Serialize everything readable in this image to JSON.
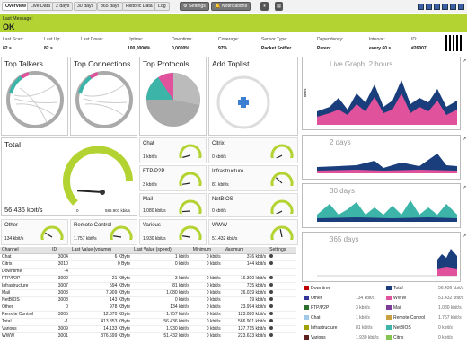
{
  "tabs": [
    "Overview",
    "Live Data",
    "2 days",
    "30 days",
    "365 days",
    "Historic Data",
    "Log"
  ],
  "toolbar": {
    "settings": "Settings",
    "notifications": "Notifications"
  },
  "status": {
    "label": "Last Message:",
    "value": "OK",
    "color": "#b3d332"
  },
  "info": [
    {
      "label": "Last Scan:",
      "value": "82 s"
    },
    {
      "label": "Last Up:",
      "value": "82 s"
    },
    {
      "label": "Last Down:",
      "value": ""
    },
    {
      "label": "Uptime:",
      "value": "100,0000%"
    },
    {
      "label": "Downtime:",
      "value": "0,0000%"
    },
    {
      "label": "Coverage:",
      "value": "97%"
    },
    {
      "label": "Sensor Type:",
      "value": "Packet Sniffer"
    },
    {
      "label": "Dependency:",
      "value": "Parent"
    },
    {
      "label": "Interval:",
      "value": "every 60 s"
    },
    {
      "label": "ID:",
      "value": "#26007"
    }
  ],
  "panels": {
    "top_talkers": "Top Talkers",
    "top_connections": "Top Connections",
    "top_protocols": "Top Protocols",
    "add_toplist": "Add Toplist"
  },
  "total": {
    "label": "Total",
    "value": "56.436 kbit/s",
    "gauge_min": "0",
    "gauge_max": "586.901 kbit/s",
    "fraction": 0.1
  },
  "gauges": [
    {
      "name": "Chat",
      "value": "1 kbit/s",
      "fraction": 0.05
    },
    {
      "name": "Citrix",
      "value": "0 kbit/s",
      "fraction": 0.0
    },
    {
      "name": "FTP/P2P",
      "value": "3 kbit/s",
      "fraction": 0.08
    },
    {
      "name": "Infrastructure",
      "value": "81 kbit/s",
      "fraction": 0.3
    },
    {
      "name": "Mail",
      "value": "1.080 kbit/s",
      "fraction": 0.1
    },
    {
      "name": "NetBIOS",
      "value": "0 kbit/s",
      "fraction": 0.0
    },
    {
      "name": "Other",
      "value": "134 kbit/s",
      "fraction": 0.25
    },
    {
      "name": "Remote Control",
      "value": "1.757 kbit/s",
      "fraction": 0.15
    },
    {
      "name": "Various",
      "value": "1.930 kbit/s",
      "fraction": 0.15
    },
    {
      "name": "WWW",
      "value": "51.432 kbit/s",
      "fraction": 0.45
    }
  ],
  "table": {
    "headers": [
      "Channel",
      "ID",
      "Last Value (volume)",
      "Last Value (speed)",
      "Minimum",
      "Maximum",
      "Settings"
    ],
    "rows": [
      [
        "Chat",
        "3004",
        "6 KByte",
        "1 kbit/s",
        "0 kbit/s",
        "376 kbit/s"
      ],
      [
        "Citrix",
        "3010",
        "0 Byte",
        "0 kbit/s",
        "0 kbit/s",
        "144 kbit/s"
      ],
      [
        "Downtime",
        "-4",
        "",
        "",
        "",
        ""
      ],
      [
        "FTP/P2P",
        "3002",
        "21 KByte",
        "3 kbit/s",
        "0 kbit/s",
        "16.300 kbit/s"
      ],
      [
        "Infrastructure",
        "3007",
        "594 KByte",
        "81 kbit/s",
        "0 kbit/s",
        "735 kbit/s"
      ],
      [
        "Mail",
        "3003",
        "7.909 KByte",
        "1.080 kbit/s",
        "0 kbit/s",
        "26.039 kbit/s"
      ],
      [
        "NetBIOS",
        "3008",
        "143 KByte",
        "0 kbit/s",
        "0 kbit/s",
        "19 kbit/s"
      ],
      [
        "Other",
        "0",
        "978 KByte",
        "134 kbit/s",
        "0 kbit/s",
        "23.994 kbit/s"
      ],
      [
        "Remote Control",
        "3005",
        "12.870 KByte",
        "1.757 kbit/s",
        "0 kbit/s",
        "123.080 kbit/s"
      ],
      [
        "Total",
        "-1",
        "413.353 KByte",
        "56.436 kbit/s",
        "0 kbit/s",
        "586.901 kbit/s"
      ],
      [
        "Various",
        "3009",
        "14.133 KByte",
        "1.930 kbit/s",
        "0 kbit/s",
        "137.715 kbit/s"
      ],
      [
        "WWW",
        "3001",
        "376.699 KByte",
        "51.432 kbit/s",
        "0 kbit/s",
        "223.633 kbit/s"
      ]
    ]
  },
  "graphs": {
    "live": "Live Graph, 2 hours",
    "two_days": "2 days",
    "thirty_days": "30 days",
    "year": "365 days",
    "y_unit": "kbit/s"
  },
  "legend": [
    {
      "name": "Downtime",
      "value": "",
      "color": "#c00000"
    },
    {
      "name": "Total",
      "value": "56.436 kbit/s",
      "color": "#1a3d7c"
    },
    {
      "name": "Other",
      "value": "134 kbit/s",
      "color": "#333399"
    },
    {
      "name": "WWW",
      "value": "51.432 kbit/s",
      "color": "#e0529c"
    },
    {
      "name": "FTP/P2P",
      "value": "3 kbit/s",
      "color": "#2b6f2b"
    },
    {
      "name": "Mail",
      "value": "1.080 kbit/s",
      "color": "#7d3c98"
    },
    {
      "name": "Chat",
      "value": "1 kbit/s",
      "color": "#a0c8e8"
    },
    {
      "name": "Remote Control",
      "value": "1.757 kbit/s",
      "color": "#c8a040"
    },
    {
      "name": "Infrastructure",
      "value": "81 kbit/s",
      "color": "#a0a000"
    },
    {
      "name": "NetBIOS",
      "value": "0 kbit/s",
      "color": "#3cb4a8"
    },
    {
      "name": "Various",
      "value": "1.930 kbit/s",
      "color": "#602020"
    },
    {
      "name": "Citrix",
      "value": "0 kbit/s",
      "color": "#84c450"
    }
  ]
}
